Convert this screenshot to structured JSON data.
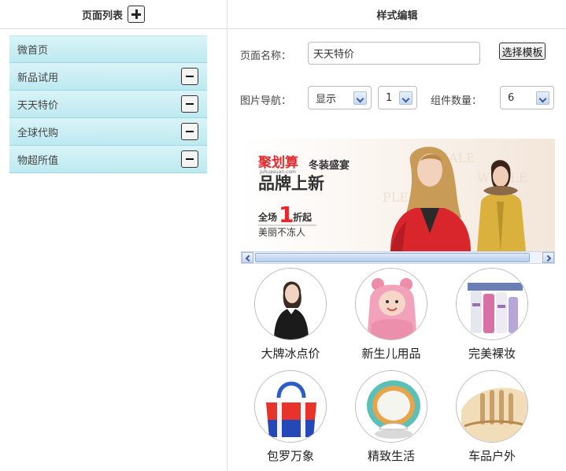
{
  "left_panel": {
    "title": "页面列表",
    "pages": [
      {
        "label": "微首页",
        "removable": false
      },
      {
        "label": "新品试用",
        "removable": true
      },
      {
        "label": "天天特价",
        "removable": true
      },
      {
        "label": "全球代购",
        "removable": true
      },
      {
        "label": "物超所值",
        "removable": true
      }
    ]
  },
  "right_panel": {
    "title": "样式编辑",
    "page_name_label": "页面名称：",
    "page_name_value": "天天特价",
    "template_button": "选择模板",
    "nav_label": "图片导航：",
    "nav_display_value": "显示",
    "nav_count_value": "1",
    "component_count_label": "组件数量：",
    "component_count_value": "6"
  },
  "banner": {
    "brand": "聚划算",
    "brand_url": "juhuasuan.com",
    "tagline": "冬装盛宴",
    "headline": "品牌上新",
    "promo_prefix": "全场",
    "promo_number": "1",
    "promo_suffix": "折起",
    "slogan": "美丽不冻人"
  },
  "categories": [
    {
      "label": "大牌冰点价"
    },
    {
      "label": "新生儿用品"
    },
    {
      "label": "完美裸妆"
    },
    {
      "label": "包罗万象"
    },
    {
      "label": "精致生活"
    },
    {
      "label": "车品户外"
    }
  ],
  "colors": {
    "list_item_bg": "#c9eef4",
    "accent_red": "#e8272b",
    "border": "#dcdcdc"
  }
}
